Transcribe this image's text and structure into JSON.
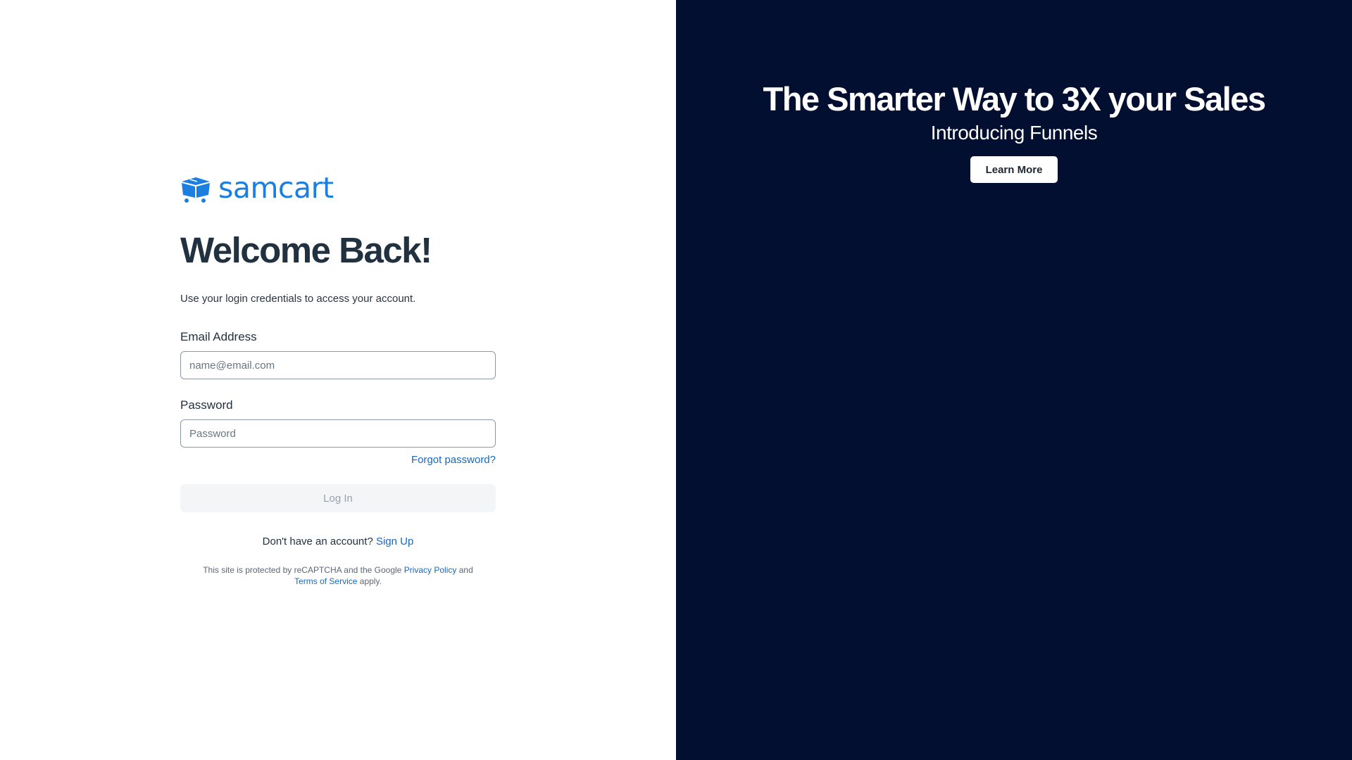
{
  "brand": {
    "name": "samcart",
    "logo_icon": "cart-box-icon",
    "color": "#1a7fe0"
  },
  "login": {
    "title": "Welcome Back!",
    "subtitle": "Use your login credentials to access your account.",
    "email_label": "Email Address",
    "email_placeholder": "name@email.com",
    "email_value": "",
    "password_label": "Password",
    "password_placeholder": "Password",
    "password_value": "",
    "forgot_label": "Forgot password?",
    "login_label": "Log In",
    "signup_prompt": "Don't have an account?",
    "signup_label": "Sign Up"
  },
  "recaptcha": {
    "text_1": "This site is protected by reCAPTCHA and the Google",
    "privacy_label": "Privacy Policy",
    "text_2": "and",
    "terms_label": "Terms of Service",
    "text_3": "apply."
  },
  "promo": {
    "headline": "The Smarter Way to 3X your Sales",
    "subheadline": "Introducing Funnels",
    "button_label": "Learn More",
    "background": "#020f30"
  },
  "colors": {
    "link": "#1469c7",
    "heading": "#22313f",
    "button_disabled_bg": "#f3f5f7"
  }
}
